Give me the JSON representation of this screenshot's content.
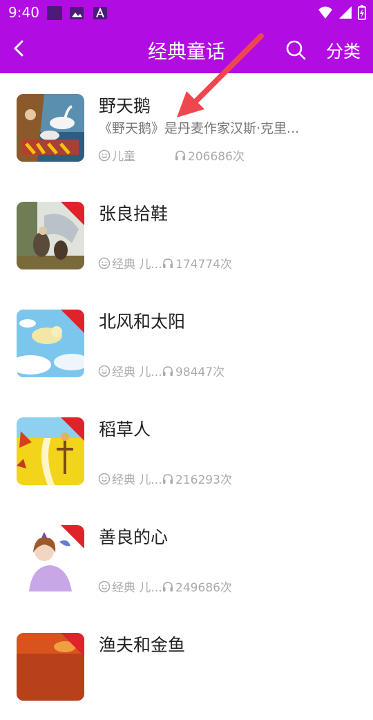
{
  "status_bar": {
    "time": "9:40"
  },
  "app_bar": {
    "title": "经典童话",
    "category_label": "分类",
    "accent": "#b10de2"
  },
  "stories": [
    {
      "title": "野天鹅",
      "description": "《野天鹅》是丹麦作家汉斯·克里...",
      "tag": "儿童",
      "plays": "206686次"
    },
    {
      "title": "张良拾鞋",
      "description": "",
      "tag": "经典 儿...",
      "plays": "174774次"
    },
    {
      "title": "北风和太阳",
      "description": "",
      "tag": "经典 儿...",
      "plays": "98447次"
    },
    {
      "title": "稻草人",
      "description": "",
      "tag": "经典 儿...",
      "plays": "216293次"
    },
    {
      "title": "善良的心",
      "description": "",
      "tag": "经典 儿...",
      "plays": "249686次"
    },
    {
      "title": "渔夫和金鱼",
      "description": "",
      "tag": "",
      "plays": ""
    }
  ],
  "icons": {
    "back": "chevron-left-icon",
    "search": "search-icon",
    "tag": "smiley-icon",
    "plays": "headphones-icon"
  }
}
